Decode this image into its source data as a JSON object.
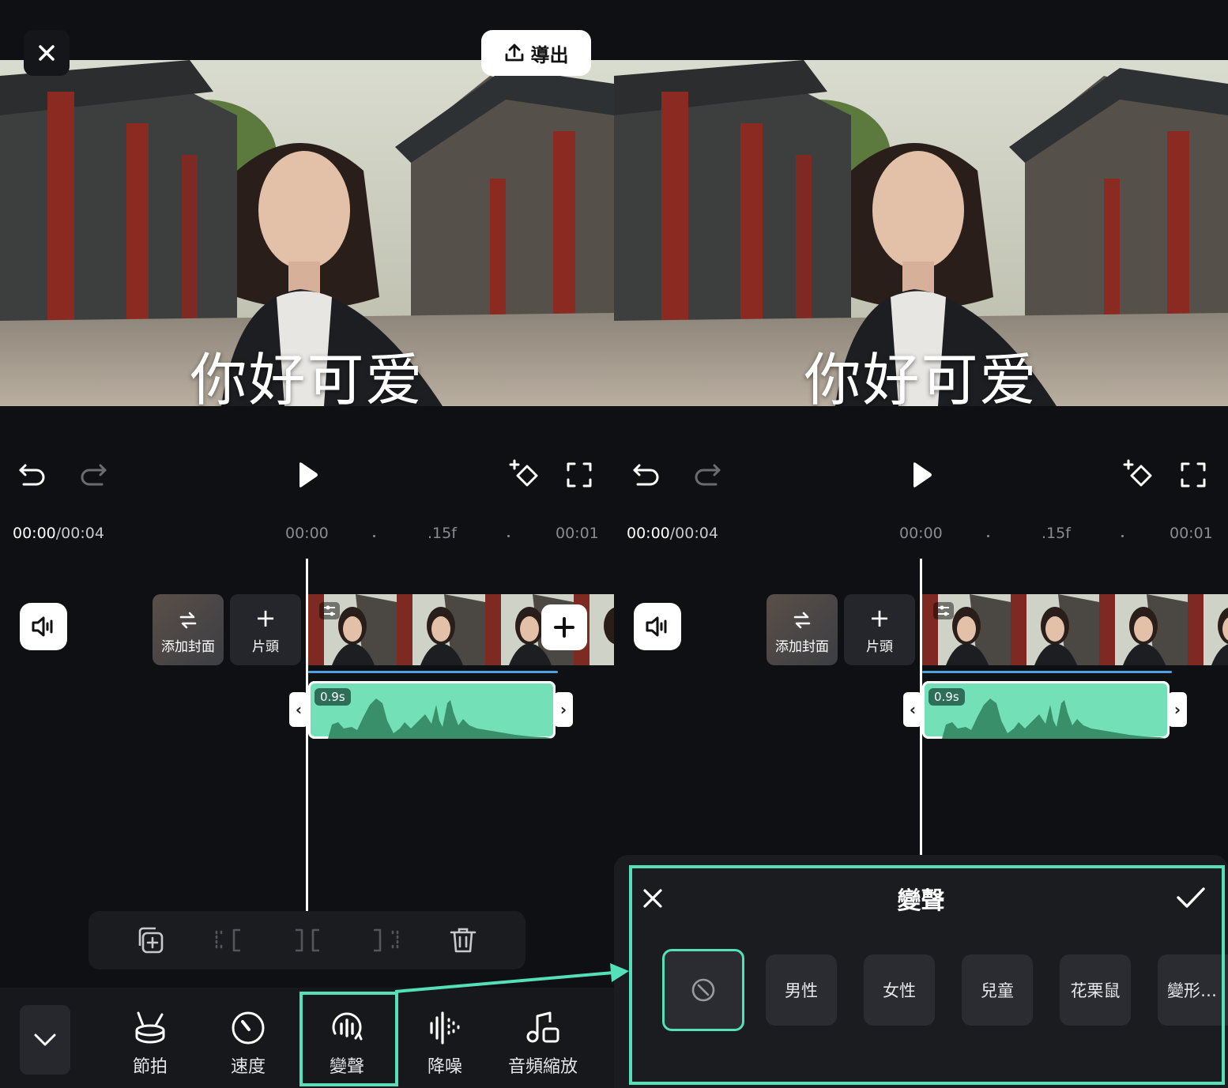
{
  "header": {
    "export_label": "導出"
  },
  "preview": {
    "caption": "你好可爱"
  },
  "timeline": {
    "current_time": "00:00",
    "total_time": "/00:04",
    "ruler_ticks": [
      "00:00",
      ".15f",
      "00:01"
    ],
    "cover_label": "添加封面",
    "head_label": "片頭",
    "head_plus": "+",
    "audio_duration": "0.9s"
  },
  "bottom_toolbar": {
    "tools": [
      {
        "label": "節拍",
        "icon": "beat-icon"
      },
      {
        "label": "速度",
        "icon": "speed-icon"
      },
      {
        "label": "變聲",
        "icon": "voice-change-icon"
      },
      {
        "label": "降噪",
        "icon": "noise-reduction-icon"
      },
      {
        "label": "音頻縮放",
        "icon": "audio-zoom-icon"
      }
    ]
  },
  "voice_sheet": {
    "title": "變聲",
    "options": [
      "男性",
      "女性",
      "兒童",
      "花栗鼠",
      "變形…"
    ]
  },
  "colors": {
    "accent": "#54e0b8",
    "audio_clip": "#74e0b8",
    "background": "#0f1013"
  }
}
